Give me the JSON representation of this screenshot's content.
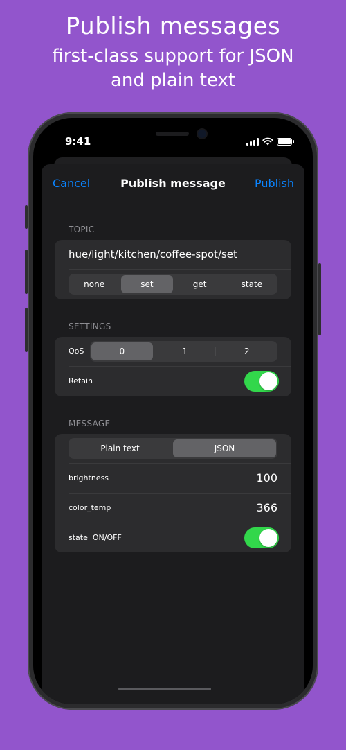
{
  "promo": {
    "title": "Publish messages",
    "subtitle_line1": "first-class support for JSON",
    "subtitle_line2": "and plain text"
  },
  "status_bar": {
    "time": "9:41",
    "icons": [
      "cellular-signal-icon",
      "wifi-icon",
      "battery-icon"
    ]
  },
  "nav": {
    "cancel": "Cancel",
    "title": "Publish message",
    "publish": "Publish"
  },
  "topic": {
    "section_label": "TOPIC",
    "value": "hue/light/kitchen/coffee-spot/set",
    "suffix_options": [
      "none",
      "set",
      "get",
      "state"
    ],
    "selected_suffix": "set"
  },
  "settings": {
    "section_label": "SETTINGS",
    "qos_label": "QoS",
    "qos_options": [
      "0",
      "1",
      "2"
    ],
    "selected_qos": "0",
    "retain_label": "Retain",
    "retain_on": true
  },
  "message": {
    "section_label": "MESSAGE",
    "format_options": [
      "Plain text",
      "JSON"
    ],
    "selected_format": "JSON",
    "fields": [
      {
        "key": "brightness",
        "value": "100"
      },
      {
        "key": "color_temp",
        "value": "366"
      }
    ],
    "state_label": "state",
    "state_hint": "ON/OFF",
    "state_on": true
  },
  "colors": {
    "background": "#9255cc",
    "accent": "#0a84ff",
    "toggle_on": "#32d74b"
  }
}
